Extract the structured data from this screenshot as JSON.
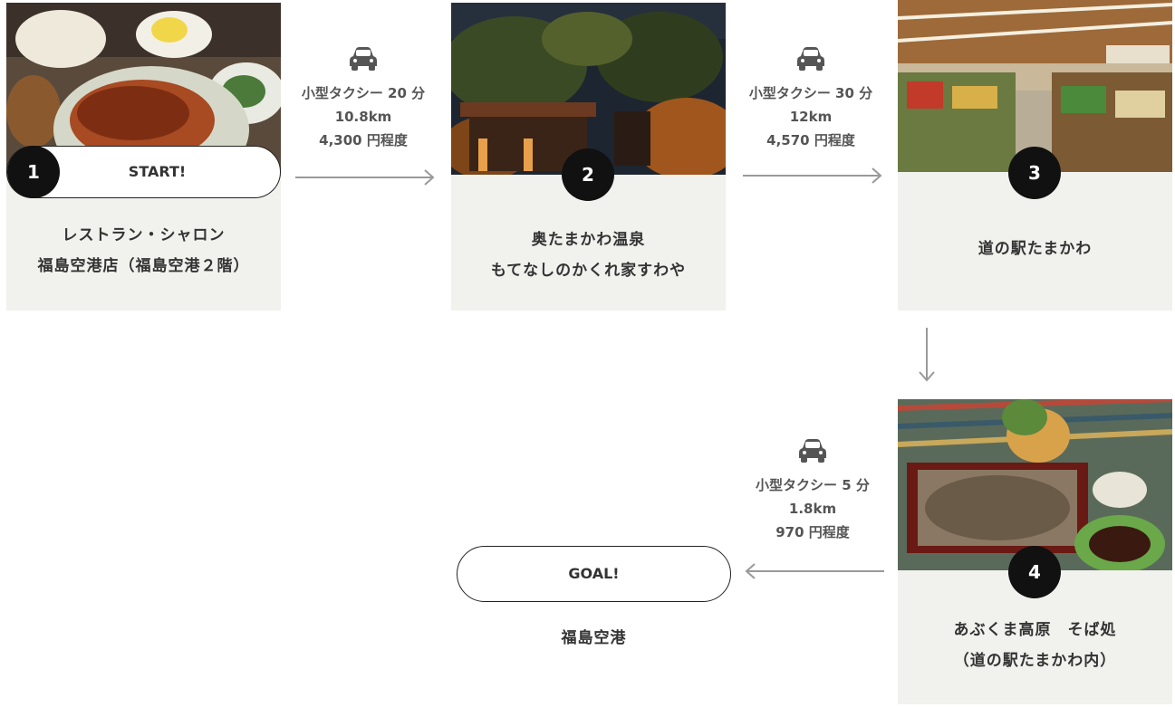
{
  "route": {
    "start_label": "START!",
    "goal_label": "GOAL!",
    "goal_place": "福島空港",
    "stops": [
      {
        "number": "1",
        "name_line1": "レストラン・シャロン",
        "name_line2": "福島空港店（福島空港２階）"
      },
      {
        "number": "2",
        "name_line1": "奥たまかわ温泉",
        "name_line2": "もてなしのかくれ家すわや"
      },
      {
        "number": "3",
        "name_line1": "道の駅たまかわ",
        "name_line2": ""
      },
      {
        "number": "4",
        "name_line1": "あぶくま高原　そば処",
        "name_line2": "（道の駅たまかわ内）"
      }
    ],
    "legs": [
      {
        "mode": "小型タクシー 20 分",
        "distance": "10.8km",
        "fare": "4,300 円程度",
        "icon": "car-icon"
      },
      {
        "mode": "小型タクシー 30 分",
        "distance": "12km",
        "fare": "4,570 円程度",
        "icon": "car-icon"
      },
      {
        "mode": "小型タクシー 5 分",
        "distance": "1.8km",
        "fare": "970 円程度",
        "icon": "car-icon"
      }
    ]
  },
  "colors": {
    "card_bg": "#f1f1ee",
    "badge_bg": "#111111",
    "arrow": "#999999",
    "icon": "#555555"
  }
}
